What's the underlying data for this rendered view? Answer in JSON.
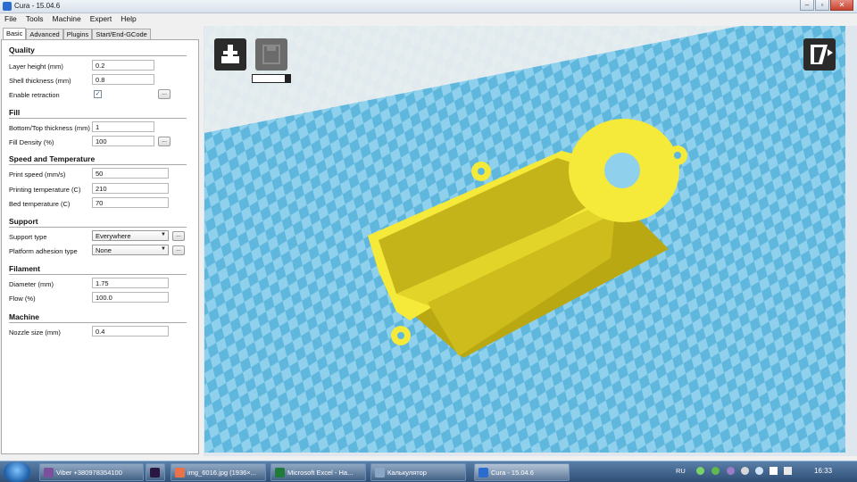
{
  "window": {
    "title": "Cura - 15.04.6"
  },
  "menu": [
    "File",
    "Tools",
    "Machine",
    "Expert",
    "Help"
  ],
  "tabs": [
    "Basic",
    "Advanced",
    "Plugins",
    "Start/End-GCode"
  ],
  "sections": {
    "quality": "Quality",
    "fill": "Fill",
    "speed": "Speed and Temperature",
    "support": "Support",
    "filament": "Filament",
    "machine": "Machine"
  },
  "settings": {
    "layer_height": {
      "label": "Layer height (mm)",
      "value": "0.2"
    },
    "shell_thickness": {
      "label": "Shell thickness (mm)",
      "value": "0.8"
    },
    "enable_retraction": {
      "label": "Enable retraction",
      "checked": true
    },
    "bottom_top_thickness": {
      "label": "Bottom/Top thickness (mm)",
      "value": "1"
    },
    "fill_density": {
      "label": "Fill Density (%)",
      "value": "100"
    },
    "print_speed": {
      "label": "Print speed (mm/s)",
      "value": "50"
    },
    "printing_temperature": {
      "label": "Printing temperature (C)",
      "value": "210"
    },
    "bed_temperature": {
      "label": "Bed temperature (C)",
      "value": "70"
    },
    "support_type": {
      "label": "Support type",
      "value": "Everywhere"
    },
    "platform_adhesion": {
      "label": "Platform adhesion type",
      "value": "None"
    },
    "diameter": {
      "label": "Diameter (mm)",
      "value": "1.75"
    },
    "flow": {
      "label": "Flow (%)",
      "value": "100.0"
    },
    "nozzle_size": {
      "label": "Nozzle size (mm)",
      "value": "0.4"
    }
  },
  "dots_label": "...",
  "checkmark": "✓",
  "viewport": {
    "bed_color_light": "#8fd0ec",
    "bed_color_dark": "#5fb7dd",
    "model_color": "#f5e93a",
    "model_shadow": "#b9a812",
    "progress_fraction": 0.85
  },
  "taskbar": {
    "items": [
      {
        "label": "Viber +380978354100",
        "icon_color": "#7b519d"
      },
      {
        "label": "",
        "icon_color": "#2a1642"
      },
      {
        "label": "img_6016.jpg (1936×...",
        "icon_color": "#e8734a"
      },
      {
        "label": "Microsoft Excel - На...",
        "icon_color": "#1f7a3c"
      },
      {
        "label": "Калькулятор",
        "icon_color": "#8aa7c6"
      },
      {
        "label": "Cura - 15.04.6",
        "icon_color": "#2a6ccf"
      }
    ],
    "lang": "RU",
    "time": "16:33"
  }
}
